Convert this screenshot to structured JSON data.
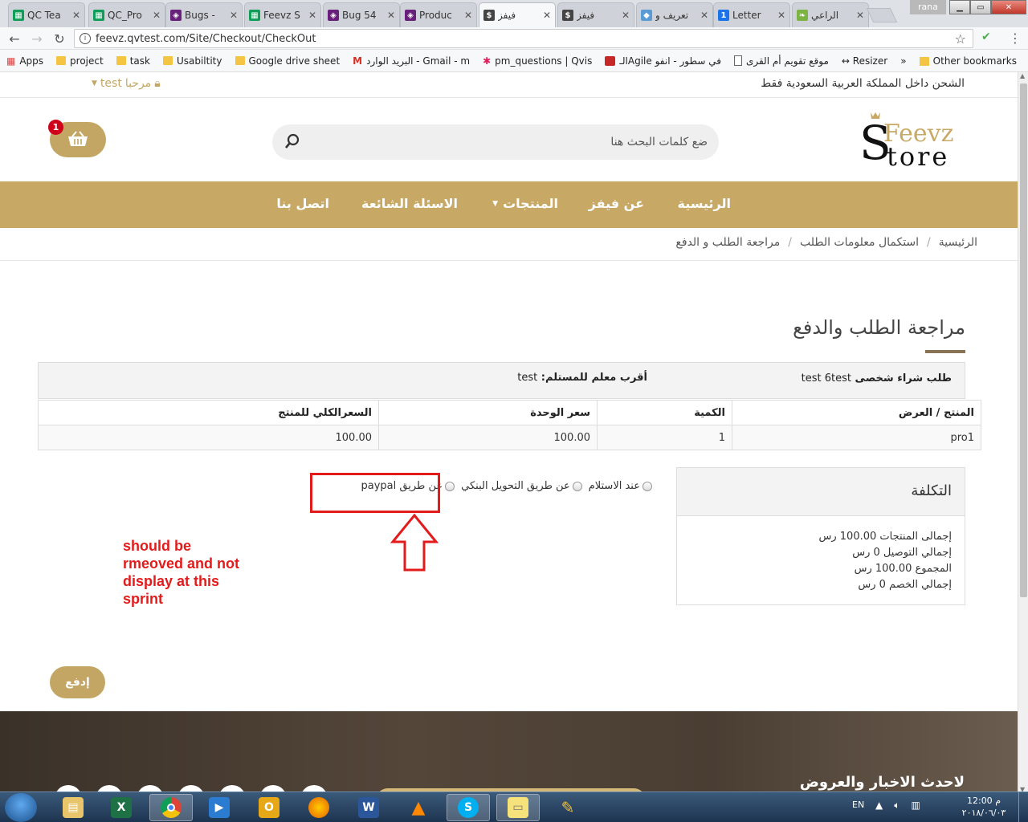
{
  "browser": {
    "tabs": [
      {
        "label": "QC Tea",
        "fav_color": "#0f9d58",
        "fav_char": "▦"
      },
      {
        "label": "QC_Pro",
        "fav_color": "#0f9d58",
        "fav_char": "▦"
      },
      {
        "label": "Bugs -",
        "fav_color": "#68217a",
        "fav_char": "◈"
      },
      {
        "label": "Feevz S",
        "fav_color": "#0f9d58",
        "fav_char": "▦"
      },
      {
        "label": "Bug 54",
        "fav_color": "#68217a",
        "fav_char": "◈"
      },
      {
        "label": "Produc",
        "fav_color": "#68217a",
        "fav_char": "◈"
      },
      {
        "label": "فيفز",
        "fav_color": "#444444",
        "fav_char": "$"
      },
      {
        "label": "فيفز",
        "fav_color": "#444444",
        "fav_char": "$"
      },
      {
        "label": "تعريف و",
        "fav_color": "#5b9bd5",
        "fav_char": "◆"
      },
      {
        "label": "Letter",
        "fav_color": "#1a73e8",
        "fav_char": "1"
      },
      {
        "label": "الراعي",
        "fav_color": "#7cb342",
        "fav_char": "❧"
      }
    ],
    "user_name": "rana",
    "url": "feevz.qvtest.com/Site/Checkout/CheckOut",
    "bookmarks": [
      {
        "label": "Apps",
        "icon": "apps-grid-icon"
      },
      {
        "label": "project",
        "icon": "folder-icon"
      },
      {
        "label": "task",
        "icon": "folder-icon"
      },
      {
        "label": "Usabiltity",
        "icon": "folder-icon"
      },
      {
        "label": "Google drive sheet",
        "icon": "folder-icon"
      },
      {
        "label": "البريد الوارد - Gmail - m",
        "icon": "gmail-icon"
      },
      {
        "label": "pm_questions | Qvis",
        "icon": "slack-icon"
      },
      {
        "label": "الـAgile في سطور - انفو",
        "icon": "red-site-icon"
      },
      {
        "label": "موقع تقويم أم القرى",
        "icon": "page-icon"
      },
      {
        "label": "↔ Resizer",
        "icon": "resizer-icon"
      }
    ],
    "bookmarks_overflow": "»",
    "other_bookmarks": "Other bookmarks"
  },
  "site": {
    "shipping_note": "الشحن داخل المملكة العربية السعودية فقط",
    "welcome_label": "مرحبا",
    "user": "test",
    "logo_top": "Feevz",
    "logo_bottom": "tore",
    "logo_initial": "S",
    "search_placeholder": "ضع كلمات البحث هنا",
    "cart_count": "1",
    "accent_color": "#c8a865",
    "nav": {
      "home": "الرئيسية",
      "about": "عن فيفز",
      "products": "المنتجات",
      "faq": "الاسئلة الشائعة",
      "contact": "اتصل بنا"
    },
    "breadcrumb": {
      "home": "الرئيسية",
      "step2": "استكمال معلومات الطلب",
      "current": "مراجعة الطلب و الدفع",
      "separator": "/"
    }
  },
  "checkout": {
    "title": "مراجعة الطلب والدفع",
    "order_type_label": "طلب شراء شخصى",
    "order_type_value": "test 6test",
    "nearest_label": "أقرب معلم للمستلم:",
    "nearest_value": "test",
    "table": {
      "headers": [
        "المنتج / العرض",
        "الكمية",
        "سعر الوحدة",
        "السعرالكلي للمنتج"
      ],
      "rows": [
        [
          "pro1",
          "1",
          "100.00",
          "100.00"
        ]
      ]
    },
    "cost": {
      "title": "التكلفة",
      "products_total": "إجمالى المنتجات 100.00 رس",
      "delivery_total": "إجمالي التوصيل 0 رس",
      "grand_total": "المجموع 100.00 رس",
      "discount_total": "إجمالي الخصم 0 رس"
    },
    "payment_options": [
      "عند الاستلام",
      "عن طريق التحويل البنكي",
      "عن طريق paypal"
    ],
    "pay_button": "إدفع"
  },
  "annotation": {
    "text_lines": [
      "should  be",
      "rmeoved and not",
      "display at this",
      "sprint"
    ],
    "color": "#e31b1b"
  },
  "footer": {
    "newsletter_title": "لاحدث الاخبار والعروض"
  },
  "taskbar": {
    "lang": "EN",
    "time": "12:00 م",
    "date": "٢٠١٨/٠٦/٠٣"
  }
}
